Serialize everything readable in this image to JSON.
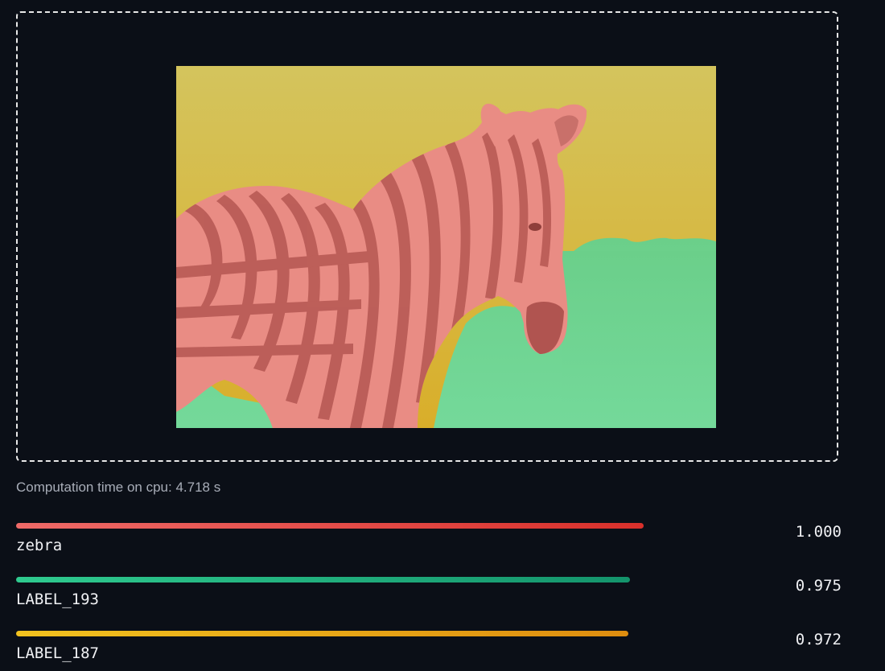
{
  "caption": "Computation time on cpu: 4.718 s",
  "colors": {
    "background": "#0b0f17",
    "zebra": "#e44a45",
    "label_193": "#1aa67a",
    "label_187": "#e2a017"
  },
  "segmentation": {
    "icon": "segmented-zebra-image"
  },
  "results": [
    {
      "label": "zebra",
      "score": "1.000",
      "level": 1.0
    },
    {
      "label": "LABEL_193",
      "score": "0.975",
      "level": 0.975
    },
    {
      "label": "LABEL_187",
      "score": "0.972",
      "level": 0.972
    }
  ]
}
